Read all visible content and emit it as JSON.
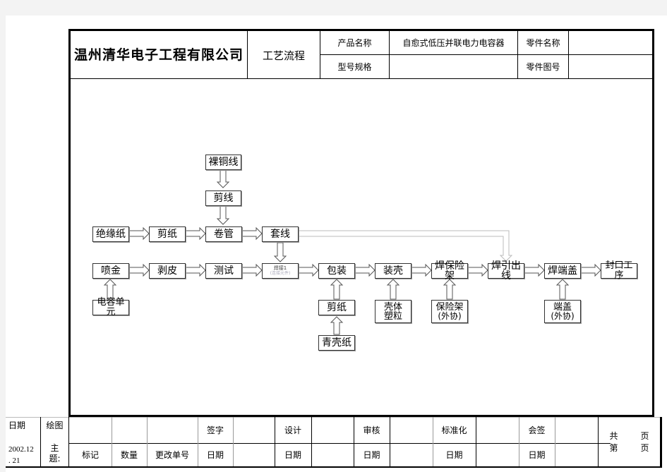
{
  "header": {
    "company": "温州清华电子工程有限公司",
    "doc_type": "工艺流程",
    "product_name_label": "产品名称",
    "product_name_value": "自愈式低压并联电力电容器",
    "model_label": "型号规格",
    "model_value": "",
    "part_name_label": "零件名称",
    "part_name_value": "",
    "part_drawing_label": "零件图号",
    "part_drawing_value": ""
  },
  "flow": {
    "nodes": {
      "bare_copper_wire": "裸铜线",
      "cut_wire": "剪线",
      "insulation_paper": "绝缘纸",
      "cut_paper": "剪纸",
      "winding": "卷管",
      "sleeving": "套线",
      "spray_gold": "喷金",
      "peeling": "剥皮",
      "testing": "测试",
      "welding1_line1": "焊接1",
      "welding1_line2": "(连接元件)",
      "wrapping": "包装",
      "case_assembly": "装壳",
      "weld_fuse_holder": "焊保险架",
      "weld_lead_wire": "焊引出线",
      "weld_end_cap": "焊端盖",
      "sealing": "封口工序",
      "capacitor_unit": "电容单元",
      "cut_paper_2": "剪纸",
      "green_shell_paper": "青壳纸",
      "shell_pellets_line1": "壳体",
      "shell_pellets_line2": "塑粒",
      "fuse_holder_line1": "保险架",
      "fuse_holder_line2": "(外协)",
      "end_cap_line1": "端盖",
      "end_cap_line2": "(外协)"
    }
  },
  "footer": {
    "date_label": "日期",
    "date_value_line1": "2002.12",
    "date_value_line2": ". 21",
    "drawing_label": "绘图",
    "subject_line1": "主",
    "subject_line2": "题:",
    "mark": "标记",
    "quantity": "数量",
    "change_no": "更改单号",
    "sign": "签字",
    "sign_date": "日期",
    "design": "设计",
    "design_date": "日期",
    "review": "审核",
    "review_date": "日期",
    "standardize": "标准化",
    "standardize_date": "日期",
    "countersign": "会签",
    "countersign_date": "日期",
    "total_pages_prefix": "共",
    "total_pages_suffix": "页",
    "page_no_prefix": "第",
    "page_no_suffix": "页"
  }
}
